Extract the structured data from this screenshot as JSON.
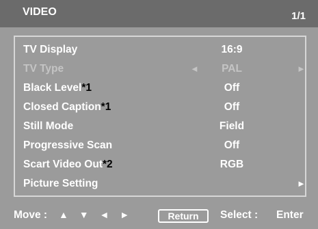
{
  "header": {
    "title": "VIDEO",
    "page": "1/1"
  },
  "menu": {
    "items": [
      {
        "label": "TV Display",
        "note": "",
        "value": "16:9",
        "left_arrow": "",
        "right_arrow": "",
        "disabled": false
      },
      {
        "label": "TV Type",
        "note": "",
        "value": "PAL",
        "left_arrow": "◄",
        "right_arrow": "►",
        "disabled": true
      },
      {
        "label": "Black Level",
        "note": "*1",
        "value": "Off",
        "left_arrow": "",
        "right_arrow": "",
        "disabled": false
      },
      {
        "label": "Closed Caption",
        "note": "*1",
        "value": "Off",
        "left_arrow": "",
        "right_arrow": "",
        "disabled": false
      },
      {
        "label": "Still Mode",
        "note": "",
        "value": "Field",
        "left_arrow": "",
        "right_arrow": "",
        "disabled": false
      },
      {
        "label": "Progressive Scan",
        "note": "",
        "value": "Off",
        "left_arrow": "",
        "right_arrow": "",
        "disabled": false
      },
      {
        "label": "Scart Video Out",
        "note": "*2",
        "value": "RGB",
        "left_arrow": "",
        "right_arrow": "",
        "disabled": false
      },
      {
        "label": "Picture Setting",
        "note": "",
        "value": "",
        "left_arrow": "",
        "right_arrow": "►",
        "disabled": false
      }
    ]
  },
  "footer": {
    "move_label": "Move :",
    "nav_arrows": "▲ ▼ ◄ ►",
    "return_label": "Return",
    "select_label": "Select :",
    "select_value": "Enter"
  },
  "colors": {
    "background": "#9b9b9b",
    "titlebar": "#6b6b6b",
    "text": "#ffffff",
    "disabled_text": "#c4c4c4",
    "note_text": "#000000"
  }
}
